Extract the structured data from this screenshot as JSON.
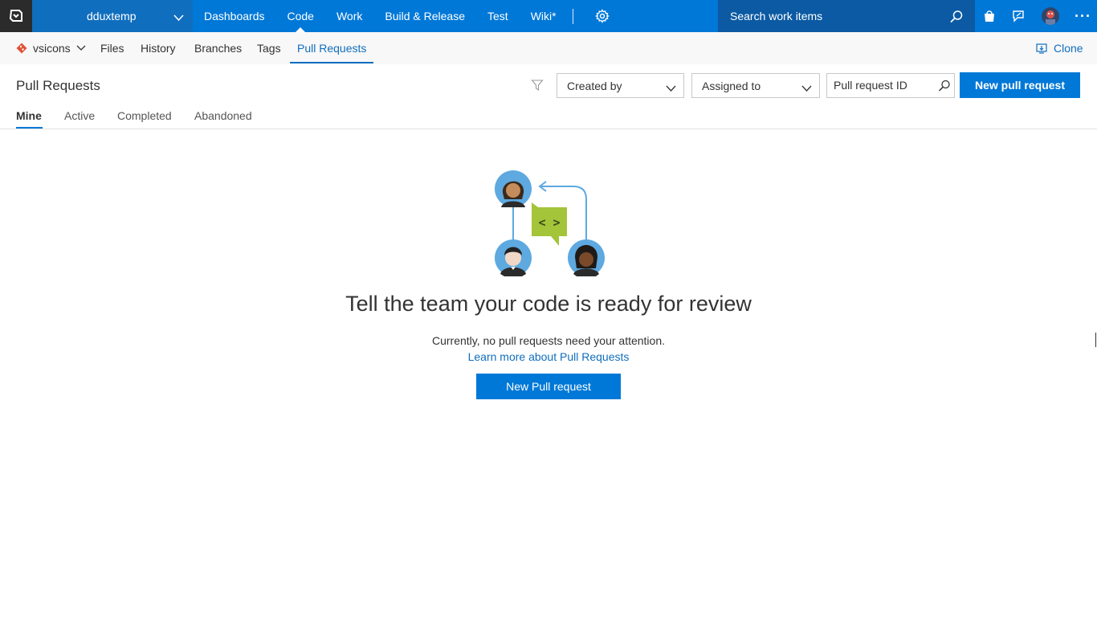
{
  "topbar": {
    "logo_icon": "vsts-logo-icon",
    "project_name": "dduxtemp",
    "nav": [
      "Dashboards",
      "Code",
      "Work",
      "Build & Release",
      "Test",
      "Wiki*"
    ],
    "active_nav": "Code",
    "search_placeholder": "Search work items",
    "icons": [
      "settings-gear-icon",
      "search-icon",
      "marketplace-bag-icon",
      "feedback-icon",
      "user-avatar",
      "more-ellipsis-icon"
    ],
    "more_label": "···"
  },
  "subbar": {
    "repo_name": "vsicons",
    "tabs": [
      "Files",
      "History",
      "Branches",
      "Tags",
      "Pull Requests"
    ],
    "active_tab": "Pull Requests",
    "clone_label": "Clone"
  },
  "header": {
    "title": "Pull Requests",
    "created_by_label": "Created by",
    "assigned_to_label": "Assigned to",
    "pr_id_placeholder": "Pull request ID",
    "new_pr_button": "New pull request"
  },
  "pivots": [
    "Mine",
    "Active",
    "Completed",
    "Abandoned"
  ],
  "active_pivot": "Mine",
  "empty_state": {
    "headline": "Tell the team your code is ready for review",
    "subtext": "Currently, no pull requests need your attention.",
    "learn_more_link": "Learn more about Pull Requests",
    "button_label": "New Pull request"
  },
  "colors": {
    "brand_blue": "#0078d7",
    "project_blue": "#106ebe",
    "search_blue": "#0b5aa3",
    "logo_dark": "#2b2b2b",
    "chat_green": "#a4c439",
    "git_red": "#e05238"
  }
}
